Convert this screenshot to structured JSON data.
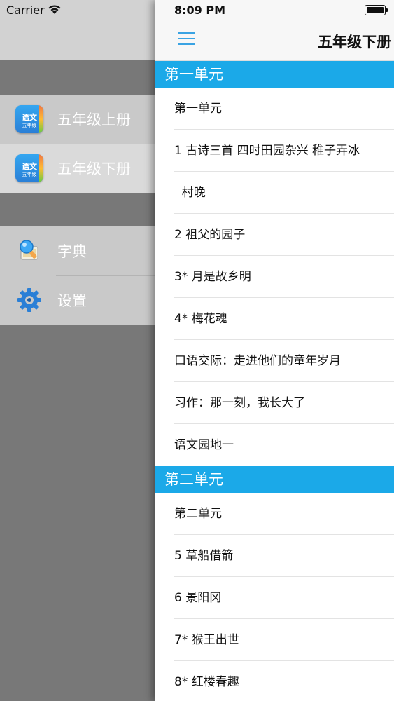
{
  "drawer": {
    "carrier": "Carrier",
    "books": [
      {
        "label": "五年级上册",
        "icon_top": "语文",
        "icon_bottom": "五年级"
      },
      {
        "label": "五年级下册",
        "icon_top": "语文",
        "icon_bottom": "五年级"
      }
    ],
    "tools": [
      {
        "label": "字典",
        "icon": "dictionary-icon"
      },
      {
        "label": "设置",
        "icon": "gear-icon"
      }
    ]
  },
  "status": {
    "time": "8:09 PM"
  },
  "nav": {
    "title": "五年级下册",
    "menu_icon": "hamburger-icon"
  },
  "sections": [
    {
      "header": "第一单元",
      "rows": [
        "第一单元",
        "1 古诗三首  四时田园杂兴  稚子弄冰",
        "  村晚",
        "2 祖父的园子",
        "3* 月是故乡明",
        "4* 梅花魂",
        "口语交际：走进他们的童年岁月",
        "习作：那一刻，我长大了",
        "语文园地一"
      ]
    },
    {
      "header": "第二单元",
      "rows": [
        "第二单元",
        "5 草船借箭",
        "6 景阳冈",
        "7* 猴王出世",
        "8* 红楼春趣"
      ]
    }
  ],
  "colors": {
    "accent": "#1ba9e8",
    "drawer_bg": "#787878"
  }
}
